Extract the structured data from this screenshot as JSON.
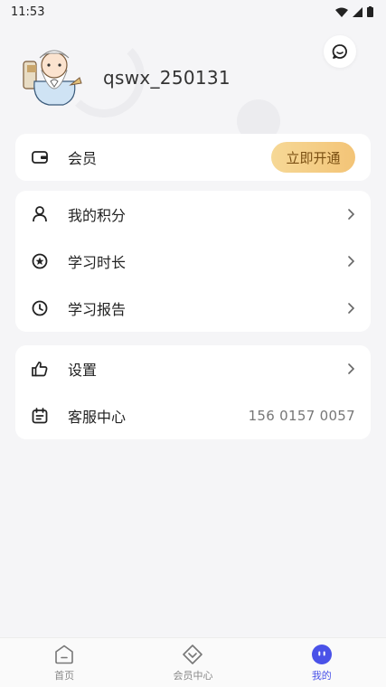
{
  "status_bar": {
    "time": "11:53"
  },
  "profile": {
    "username": "qswx_250131"
  },
  "vip_card": {
    "label": "会员",
    "button_label": "立即开通"
  },
  "menu_group_1": {
    "items": [
      {
        "label": "我的积分"
      },
      {
        "label": "学习时长"
      },
      {
        "label": "学习报告"
      }
    ]
  },
  "menu_group_2": {
    "settings_label": "设置",
    "service_label": "客服中心",
    "service_phone": "156 0157 0057"
  },
  "tabbar": {
    "tabs": [
      {
        "label": "首页"
      },
      {
        "label": "会员中心"
      },
      {
        "label": "我的"
      }
    ]
  },
  "colors": {
    "accent": "#4a52e8",
    "vip_gold": "#f3c477",
    "background": "#f5f5f7"
  }
}
